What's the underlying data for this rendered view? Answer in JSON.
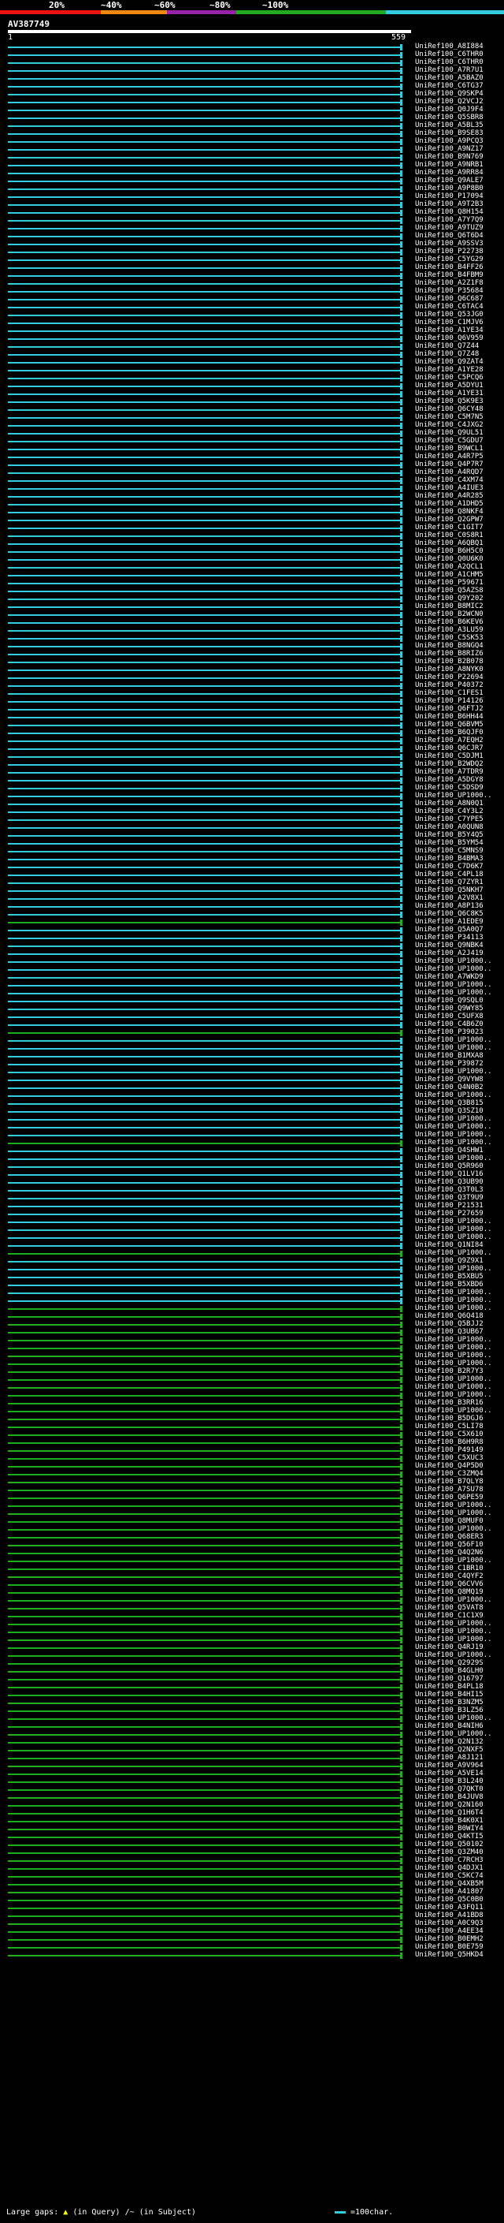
{
  "scale": {
    "labels": [
      "20%",
      "~40%",
      "~60%",
      "~80%",
      "~100%"
    ],
    "colors": [
      "#ee1111",
      "#ee8811",
      "#9922aa",
      "#22aa22",
      "#33ccdd"
    ]
  },
  "query": {
    "title": "AV387749",
    "start": "1",
    "end": "559"
  },
  "colors": {
    "blue": "#33ccdd",
    "green": "#22aa22",
    "dark": "#112233"
  },
  "hits": [
    "UniRef100_A8I884",
    "UniRef100_C6THR0",
    "UniRef100_C6THR0",
    "UniRef100_A7R7U1",
    "UniRef100_A5BAZ0",
    "UniRef100_C6TG37",
    "UniRef100_Q9SKP4",
    "UniRef100_Q2VCJ2",
    "UniRef100_Q0J9F4",
    "UniRef100_Q5SBR8",
    "UniRef100_A5BL35",
    "UniRef100_B9SE83",
    "UniRef100_A9PCQ3",
    "UniRef100_A9NZ17",
    "UniRef100_B9N769",
    "UniRef100_A9NRB1",
    "UniRef100_A9RR84",
    "UniRef100_Q9ALE7",
    "UniRef100_A9P8B0",
    "UniRef100_P17094",
    "UniRef100_A9T2B3",
    "UniRef100_Q8H154",
    "UniRef100_A7Y7Q9",
    "UniRef100_A9TUZ9",
    "UniRef100_Q6T6D4",
    "UniRef100_A9SSV3",
    "UniRef100_P22738",
    "UniRef100_C5YG29",
    "UniRef100_B4FF26",
    "UniRef100_B4FBM9",
    "UniRef100_A2Z1F8",
    "UniRef100_P35684",
    "UniRef100_Q6C687",
    "UniRef100_C6TAC4",
    "UniRef100_Q53JG0",
    "UniRef100_C1MJV6",
    "UniRef100_A1YE34",
    "UniRef100_Q6V959",
    "UniRef100_Q7Z44",
    "UniRef100_Q7Z48",
    "UniRef100_Q9ZAT4",
    "UniRef100_A1YE28",
    "UniRef100_C5PCQ6",
    "UniRef100_A5DYU1",
    "UniRef100_A1YE31",
    "UniRef100_Q5K9E3",
    "UniRef100_Q6CY48",
    "UniRef100_C5M7N5",
    "UniRef100_C4JXG2",
    "UniRef100_Q9UL51",
    "UniRef100_C5GDU7",
    "UniRef100_B9WCL1",
    "UniRef100_A4R7P5",
    "UniRef100_Q4P7R7",
    "UniRef100_A4RQD7",
    "UniRef100_C4XM74",
    "UniRef100_A4IUE3",
    "UniRef100_A4R285",
    "UniRef100_A1DHD5",
    "UniRef100_Q8NKF4",
    "UniRef100_Q2GPW7",
    "UniRef100_C1GIT7",
    "UniRef100_C0S8R1",
    "UniRef100_A6QBQ1",
    "UniRef100_B6H5C0",
    "UniRef100_Q0U6K0",
    "UniRef100_A2QCL1",
    "UniRef100_A1CHM5",
    "UniRef100_P59671",
    "UniRef100_Q5AZS8",
    "UniRef100_Q9Y202",
    "UniRef100_B8MIC2",
    "UniRef100_B2WCN0",
    "UniRef100_B6KEV6",
    "UniRef100_A3LU59",
    "UniRef100_C5SK53",
    "UniRef100_B8NGQ4",
    "UniRef100_B8RIZ6",
    "UniRef100_B2B078",
    "UniRef100_A8NYK0",
    "UniRef100_P22694",
    "UniRef100_P40372",
    "UniRef100_C1FES1",
    "UniRef100_P14126",
    "UniRef100_Q6FTJ2",
    "UniRef100_B6HH44",
    "UniRef100_Q6BVM5",
    "UniRef100_B6QJF0",
    "UniRef100_A7EQH2",
    "UniRef100_Q6CJR7",
    "UniRef100_C5DJM1",
    "UniRef100_B2WDQ2",
    "UniRef100_A7TDR9",
    "UniRef100_A5DGY8",
    "UniRef100_C5DSD9",
    "UniRef100_UP1000..",
    "UniRef100_A8N0Q1",
    "UniRef100_C4Y3L2",
    "UniRef100_C7YPE5",
    "UniRef100_A0QUN8",
    "UniRef100_B5Y4Q5",
    "UniRef100_B5YM54",
    "UniRef100_C5MNS9",
    "UniRef100_B4BMA3",
    "UniRef100_C7D6K7",
    "UniRef100_C4PL18",
    "UniRef100_Q7ZYR1",
    "UniRef100_Q5NKH7",
    "UniRef100_A2V8X1",
    "UniRef100_A8P136",
    "UniRef100_Q6C8K5",
    "UniRef100_A1EDE9",
    "UniRef100_Q5A0Q7",
    "UniRef100_P34113",
    "UniRef100_Q9NBK4",
    "UniRef100_A2J419",
    "UniRef100_UP1000..",
    "UniRef100_UP1000..",
    "UniRef100_A7WKD9",
    "UniRef100_UP1000..",
    "UniRef100_UP1000..",
    "UniRef100_Q9SQL0",
    "UniRef100_Q9WY85",
    "UniRef100_C5UFX8",
    "UniRef100_C4B6Z0",
    "UniRef100_P39023",
    "UniRef100_UP1000..",
    "UniRef100_UP1000..",
    "UniRef100_B1MXA8",
    "UniRef100_P39872",
    "UniRef100_UP1000..",
    "UniRef100_Q9VYW8",
    "UniRef100_Q4N0B2",
    "UniRef100_UP1000..",
    "UniRef100_Q3B815",
    "UniRef100_Q3SZ10",
    "UniRef100_UP1000..",
    "UniRef100_UP1000..",
    "UniRef100_UP1000..",
    "UniRef100_UP1000..",
    "UniRef100_Q4SHW1",
    "UniRef100_UP1000..",
    "UniRef100_Q5R960",
    "UniRef100_Q1LV16",
    "UniRef100_Q3UB90",
    "UniRef100_Q3T0L3",
    "UniRef100_Q3T9U9",
    "UniRef100_P21531",
    "UniRef100_P27659",
    "UniRef100_UP1000..",
    "UniRef100_UP1000..",
    "UniRef100_UP1000..",
    "UniRef100_Q1NI84",
    "UniRef100_UP1000..",
    "UniRef100_Q9Z9X1",
    "UniRef100_UP1000..",
    "UniRef100_B5XBU5",
    "UniRef100_B5XBD6",
    "UniRef100_UP1000..",
    "UniRef100_UP1000..",
    "UniRef100_UP1000..",
    "UniRef100_Q6Q418",
    "UniRef100_Q5BJJ2",
    "UniRef100_Q3UB67",
    "UniRef100_UP1000..",
    "UniRef100_UP1000..",
    "UniRef100_UP1000..",
    "UniRef100_UP1000..",
    "UniRef100_B2R7Y3",
    "UniRef100_UP1000..",
    "UniRef100_UP1000..",
    "UniRef100_UP1000..",
    "UniRef100_B3RR16",
    "UniRef100_UP1000..",
    "UniRef100_B5DGJ6",
    "UniRef100_C5LI78",
    "UniRef100_C5X610",
    "UniRef100_B6H9R8",
    "UniRef100_P49149",
    "UniRef100_C5XUC3",
    "UniRef100_Q4P5D0",
    "UniRef100_C3ZMQ4",
    "UniRef100_B7QLY8",
    "UniRef100_A7SU78",
    "UniRef100_Q6PE59",
    "UniRef100_UP1000..",
    "UniRef100_UP1000..",
    "UniRef100_Q8MUF0",
    "UniRef100_UP1000..",
    "UniRef100_Q68ER3",
    "UniRef100_Q56F10",
    "UniRef100_Q4Q2N6",
    "UniRef100_UP1000..",
    "UniRef100_C1BR10",
    "UniRef100_C4QYF2",
    "UniRef100_Q6CVV6",
    "UniRef100_Q8MQ19",
    "UniRef100_UP1000..",
    "UniRef100_Q5VAT8",
    "UniRef100_C1C1X9",
    "UniRef100_UP1000..",
    "UniRef100_UP1000..",
    "UniRef100_UP1000..",
    "UniRef100_Q4RJ19",
    "UniRef100_UP1000..",
    "UniRef100_Q2929S",
    "UniRef100_B4GLH0",
    "UniRef100_Q16797",
    "UniRef100_B4PL18",
    "UniRef100_B4HI15",
    "UniRef100_B3NZM5",
    "UniRef100_B3LZ56",
    "UniRef100_UP1000..",
    "UniRef100_B4NIH6",
    "UniRef100_UP1000..",
    "UniRef100_Q2N132",
    "UniRef100_Q2NXF5",
    "UniRef100_A8J121",
    "UniRef100_A9V964",
    "UniRef100_A5VE14",
    "UniRef100_B3L240",
    "UniRef100_Q7QKT0",
    "UniRef100_B4JUV8",
    "UniRef100_Q2N160",
    "UniRef100_Q1H6T4",
    "UniRef100_B4K0X1",
    "UniRef100_B0WIY4",
    "UniRef100_Q4KTI5",
    "UniRef100_Q50102",
    "UniRef100_Q3ZM40",
    "UniRef100_C7RCH3",
    "UniRef100_Q4DJX1",
    "UniRef100_C5KC74",
    "UniRef100_Q4XB5M",
    "UniRef100_A41807",
    "UniRef100_Q5C0B0",
    "UniRef100_A3FQ11",
    "UniRef100_A41BD8",
    "UniRef100_A0C9Q3",
    "UniRef100_A4EE34",
    "UniRef100_B0EMH2",
    "UniRef100_B0E759",
    "UniRef100_Q5HKD4"
  ],
  "legend": {
    "large_gaps": "Large gaps:",
    "in_query": "(in Query)",
    "in_subject": "/~ (in Subject)",
    "scale": "=100char."
  }
}
